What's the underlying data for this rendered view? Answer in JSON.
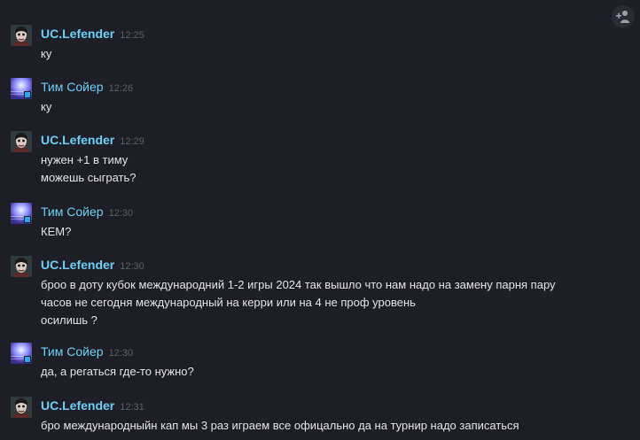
{
  "messages": [
    {
      "sender": "UC.Lefender",
      "time": "12:25",
      "lines": [
        "ку"
      ]
    },
    {
      "sender": "Тим Сойер",
      "time": "12:26",
      "lines": [
        "ку"
      ]
    },
    {
      "sender": "UC.Lefender",
      "time": "12:29",
      "lines": [
        "нужен +1 в тиму",
        "можешь сыграть?"
      ]
    },
    {
      "sender": "Тим Сойер",
      "time": "12:30",
      "lines": [
        "КЕМ?"
      ]
    },
    {
      "sender": "UC.Lefender",
      "time": "12:30",
      "lines": [
        "броо в доту кубок международний 1-2 игры 2024 так вышло что нам надо на замену парня пару",
        "часов не сегодня международный на керри или на 4 не проф уровень",
        "осилишь ?"
      ]
    },
    {
      "sender": "Тим Сойер",
      "time": "12:30",
      "lines": [
        "да, а регаться где-то нужно?"
      ]
    },
    {
      "sender": "UC.Lefender",
      "time": "12:31",
      "lines": [
        "бро международныйн кап мы 3 раз играем все офицально да на турнир надо записаться"
      ]
    }
  ],
  "colors": {
    "background": "#1e1f26",
    "name": "#6dcff6",
    "timestamp": "#5d6069",
    "text": "#e3e4e8"
  },
  "icons": {
    "add_friend": "add-friend-icon"
  }
}
